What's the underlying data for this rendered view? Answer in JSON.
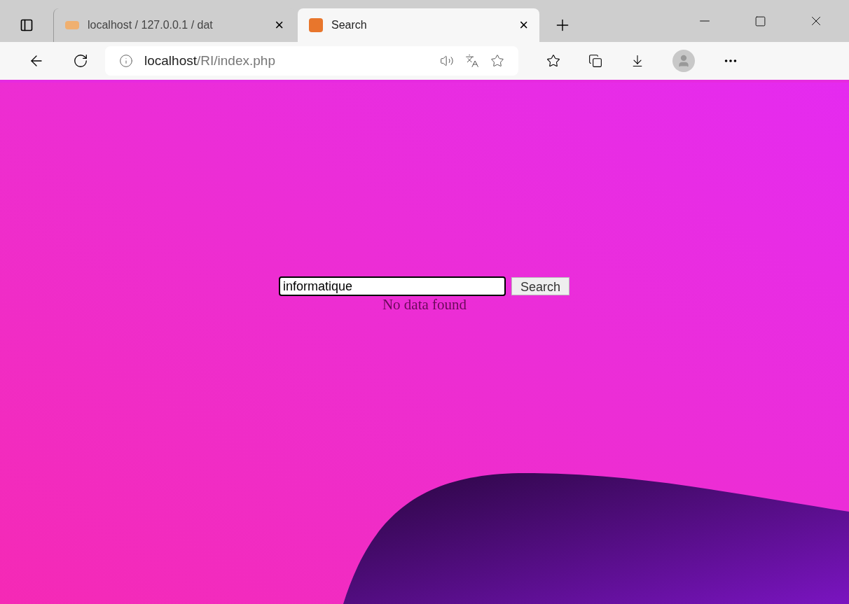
{
  "tabs": [
    {
      "title": "localhost / 127.0.0.1 / dat",
      "selected": false,
      "close": "×"
    },
    {
      "title": "Search",
      "selected": true,
      "close": "×"
    }
  ],
  "address_bar": {
    "host": "localhost",
    "path": "/RI/index.php"
  },
  "search": {
    "value": "informatique",
    "button": "Search"
  },
  "message": "No data found"
}
